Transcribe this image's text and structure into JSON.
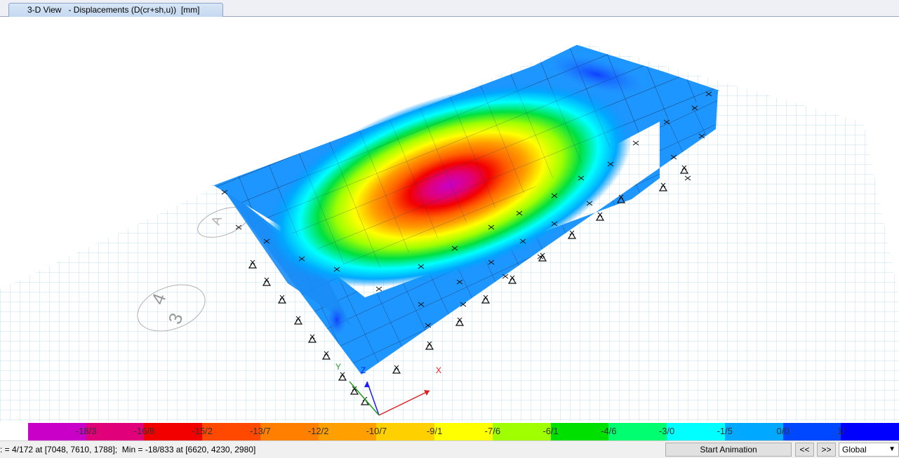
{
  "window": {
    "tab_title": "3-D View   - Displacements (D(cr+sh,u))  [mm]"
  },
  "viewport": {
    "axis_labels": {
      "x": "X",
      "y": "Y",
      "z": "Z"
    },
    "grid_labels": [
      "A",
      "3",
      "4"
    ]
  },
  "legend": {
    "labels": [
      "-18/3",
      "-16/8",
      "-15/2",
      "-13/7",
      "-12/2",
      "-10/7",
      "-9/1",
      "-7/6",
      "-6/1",
      "-4/6",
      "-3/0",
      "-1/5",
      "0/0",
      "1/"
    ],
    "colors": [
      "#c800c8",
      "#e0007a",
      "#f20000",
      "#ff4800",
      "#ff7f00",
      "#ffa000",
      "#ffd000",
      "#ffff00",
      "#a0ff00",
      "#00e000",
      "#00ff70",
      "#00ffff",
      "#00a8ff",
      "#0048ff",
      "#0000ff"
    ]
  },
  "status": {
    "text": ": = 4/172 at [7048, 7610, 1788];  Min = -18/833 at [6620, 4230, 2980]",
    "start_animation": "Start Animation",
    "prev": "<<",
    "next": ">>",
    "coord_system": "Global"
  }
}
